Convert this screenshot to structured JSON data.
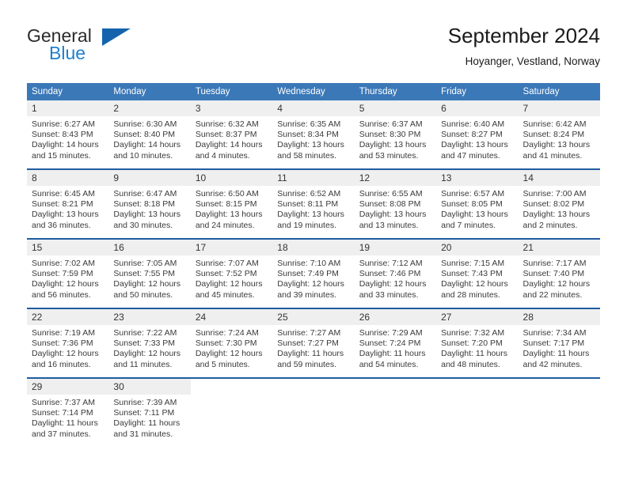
{
  "brand": {
    "name_primary": "General",
    "name_secondary": "Blue",
    "triangle_color": "#1464ad",
    "blue_color": "#1f7fd0"
  },
  "header": {
    "title": "September 2024",
    "subtitle": "Hoyanger, Vestland, Norway"
  },
  "theme": {
    "header_bg": "#3b78b8",
    "row_separator": "#1f5c9e",
    "daynum_bg": "#efefef"
  },
  "weekday_headers": [
    "Sunday",
    "Monday",
    "Tuesday",
    "Wednesday",
    "Thursday",
    "Friday",
    "Saturday"
  ],
  "weeks": [
    {
      "days": [
        {
          "num": "1",
          "sunrise": "Sunrise: 6:27 AM",
          "sunset": "Sunset: 8:43 PM",
          "daylight1": "Daylight: 14 hours",
          "daylight2": "and 15 minutes."
        },
        {
          "num": "2",
          "sunrise": "Sunrise: 6:30 AM",
          "sunset": "Sunset: 8:40 PM",
          "daylight1": "Daylight: 14 hours",
          "daylight2": "and 10 minutes."
        },
        {
          "num": "3",
          "sunrise": "Sunrise: 6:32 AM",
          "sunset": "Sunset: 8:37 PM",
          "daylight1": "Daylight: 14 hours",
          "daylight2": "and 4 minutes."
        },
        {
          "num": "4",
          "sunrise": "Sunrise: 6:35 AM",
          "sunset": "Sunset: 8:34 PM",
          "daylight1": "Daylight: 13 hours",
          "daylight2": "and 58 minutes."
        },
        {
          "num": "5",
          "sunrise": "Sunrise: 6:37 AM",
          "sunset": "Sunset: 8:30 PM",
          "daylight1": "Daylight: 13 hours",
          "daylight2": "and 53 minutes."
        },
        {
          "num": "6",
          "sunrise": "Sunrise: 6:40 AM",
          "sunset": "Sunset: 8:27 PM",
          "daylight1": "Daylight: 13 hours",
          "daylight2": "and 47 minutes."
        },
        {
          "num": "7",
          "sunrise": "Sunrise: 6:42 AM",
          "sunset": "Sunset: 8:24 PM",
          "daylight1": "Daylight: 13 hours",
          "daylight2": "and 41 minutes."
        }
      ]
    },
    {
      "days": [
        {
          "num": "8",
          "sunrise": "Sunrise: 6:45 AM",
          "sunset": "Sunset: 8:21 PM",
          "daylight1": "Daylight: 13 hours",
          "daylight2": "and 36 minutes."
        },
        {
          "num": "9",
          "sunrise": "Sunrise: 6:47 AM",
          "sunset": "Sunset: 8:18 PM",
          "daylight1": "Daylight: 13 hours",
          "daylight2": "and 30 minutes."
        },
        {
          "num": "10",
          "sunrise": "Sunrise: 6:50 AM",
          "sunset": "Sunset: 8:15 PM",
          "daylight1": "Daylight: 13 hours",
          "daylight2": "and 24 minutes."
        },
        {
          "num": "11",
          "sunrise": "Sunrise: 6:52 AM",
          "sunset": "Sunset: 8:11 PM",
          "daylight1": "Daylight: 13 hours",
          "daylight2": "and 19 minutes."
        },
        {
          "num": "12",
          "sunrise": "Sunrise: 6:55 AM",
          "sunset": "Sunset: 8:08 PM",
          "daylight1": "Daylight: 13 hours",
          "daylight2": "and 13 minutes."
        },
        {
          "num": "13",
          "sunrise": "Sunrise: 6:57 AM",
          "sunset": "Sunset: 8:05 PM",
          "daylight1": "Daylight: 13 hours",
          "daylight2": "and 7 minutes."
        },
        {
          "num": "14",
          "sunrise": "Sunrise: 7:00 AM",
          "sunset": "Sunset: 8:02 PM",
          "daylight1": "Daylight: 13 hours",
          "daylight2": "and 2 minutes."
        }
      ]
    },
    {
      "days": [
        {
          "num": "15",
          "sunrise": "Sunrise: 7:02 AM",
          "sunset": "Sunset: 7:59 PM",
          "daylight1": "Daylight: 12 hours",
          "daylight2": "and 56 minutes."
        },
        {
          "num": "16",
          "sunrise": "Sunrise: 7:05 AM",
          "sunset": "Sunset: 7:55 PM",
          "daylight1": "Daylight: 12 hours",
          "daylight2": "and 50 minutes."
        },
        {
          "num": "17",
          "sunrise": "Sunrise: 7:07 AM",
          "sunset": "Sunset: 7:52 PM",
          "daylight1": "Daylight: 12 hours",
          "daylight2": "and 45 minutes."
        },
        {
          "num": "18",
          "sunrise": "Sunrise: 7:10 AM",
          "sunset": "Sunset: 7:49 PM",
          "daylight1": "Daylight: 12 hours",
          "daylight2": "and 39 minutes."
        },
        {
          "num": "19",
          "sunrise": "Sunrise: 7:12 AM",
          "sunset": "Sunset: 7:46 PM",
          "daylight1": "Daylight: 12 hours",
          "daylight2": "and 33 minutes."
        },
        {
          "num": "20",
          "sunrise": "Sunrise: 7:15 AM",
          "sunset": "Sunset: 7:43 PM",
          "daylight1": "Daylight: 12 hours",
          "daylight2": "and 28 minutes."
        },
        {
          "num": "21",
          "sunrise": "Sunrise: 7:17 AM",
          "sunset": "Sunset: 7:40 PM",
          "daylight1": "Daylight: 12 hours",
          "daylight2": "and 22 minutes."
        }
      ]
    },
    {
      "days": [
        {
          "num": "22",
          "sunrise": "Sunrise: 7:19 AM",
          "sunset": "Sunset: 7:36 PM",
          "daylight1": "Daylight: 12 hours",
          "daylight2": "and 16 minutes."
        },
        {
          "num": "23",
          "sunrise": "Sunrise: 7:22 AM",
          "sunset": "Sunset: 7:33 PM",
          "daylight1": "Daylight: 12 hours",
          "daylight2": "and 11 minutes."
        },
        {
          "num": "24",
          "sunrise": "Sunrise: 7:24 AM",
          "sunset": "Sunset: 7:30 PM",
          "daylight1": "Daylight: 12 hours",
          "daylight2": "and 5 minutes."
        },
        {
          "num": "25",
          "sunrise": "Sunrise: 7:27 AM",
          "sunset": "Sunset: 7:27 PM",
          "daylight1": "Daylight: 11 hours",
          "daylight2": "and 59 minutes."
        },
        {
          "num": "26",
          "sunrise": "Sunrise: 7:29 AM",
          "sunset": "Sunset: 7:24 PM",
          "daylight1": "Daylight: 11 hours",
          "daylight2": "and 54 minutes."
        },
        {
          "num": "27",
          "sunrise": "Sunrise: 7:32 AM",
          "sunset": "Sunset: 7:20 PM",
          "daylight1": "Daylight: 11 hours",
          "daylight2": "and 48 minutes."
        },
        {
          "num": "28",
          "sunrise": "Sunrise: 7:34 AM",
          "sunset": "Sunset: 7:17 PM",
          "daylight1": "Daylight: 11 hours",
          "daylight2": "and 42 minutes."
        }
      ]
    },
    {
      "days": [
        {
          "num": "29",
          "sunrise": "Sunrise: 7:37 AM",
          "sunset": "Sunset: 7:14 PM",
          "daylight1": "Daylight: 11 hours",
          "daylight2": "and 37 minutes."
        },
        {
          "num": "30",
          "sunrise": "Sunrise: 7:39 AM",
          "sunset": "Sunset: 7:11 PM",
          "daylight1": "Daylight: 11 hours",
          "daylight2": "and 31 minutes."
        },
        {
          "num": "",
          "sunrise": "",
          "sunset": "",
          "daylight1": "",
          "daylight2": ""
        },
        {
          "num": "",
          "sunrise": "",
          "sunset": "",
          "daylight1": "",
          "daylight2": ""
        },
        {
          "num": "",
          "sunrise": "",
          "sunset": "",
          "daylight1": "",
          "daylight2": ""
        },
        {
          "num": "",
          "sunrise": "",
          "sunset": "",
          "daylight1": "",
          "daylight2": ""
        },
        {
          "num": "",
          "sunrise": "",
          "sunset": "",
          "daylight1": "",
          "daylight2": ""
        }
      ]
    }
  ]
}
